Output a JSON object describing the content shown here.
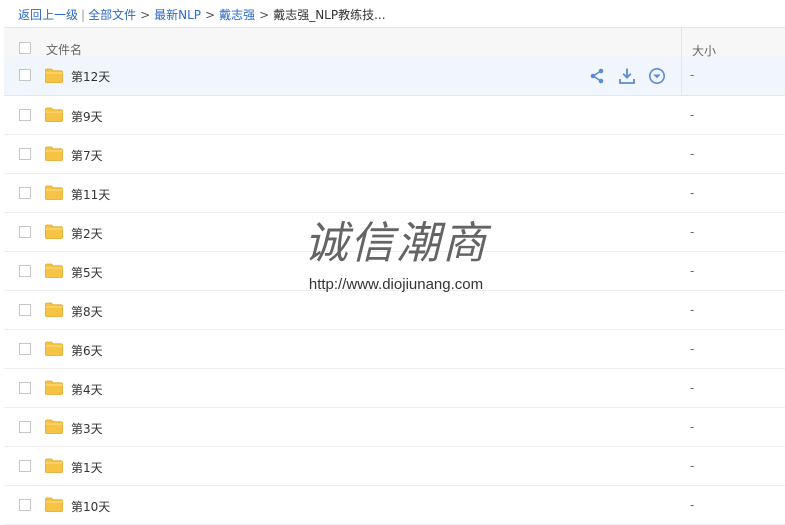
{
  "breadcrumb": {
    "back": "返回上一级",
    "divider": "|",
    "all_files": "全部文件",
    "gt": ">",
    "level1": "最新NLP",
    "level2": "戴志强",
    "current": "戴志强_NLP教练技..."
  },
  "header": {
    "name_label": "文件名",
    "size_label": "大小"
  },
  "files": [
    {
      "name": "第12天",
      "size": "-"
    },
    {
      "name": "第9天",
      "size": "-"
    },
    {
      "name": "第7天",
      "size": "-"
    },
    {
      "name": "第11天",
      "size": "-"
    },
    {
      "name": "第2天",
      "size": "-"
    },
    {
      "name": "第5天",
      "size": "-"
    },
    {
      "name": "第8天",
      "size": "-"
    },
    {
      "name": "第6天",
      "size": "-"
    },
    {
      "name": "第4天",
      "size": "-"
    },
    {
      "name": "第3天",
      "size": "-"
    },
    {
      "name": "第1天",
      "size": "-"
    },
    {
      "name": "第10天",
      "size": "-"
    }
  ],
  "row_actions": [
    "share-icon",
    "download-icon",
    "more-icon"
  ],
  "watermark": {
    "cn": "诚信潮商",
    "url": "http://www.diojiunang.com"
  },
  "colors": {
    "link": "#2b6ac6",
    "folder": "#f6c344",
    "action_icon": "#5b8ccf",
    "hover_row": "#f1f6fc"
  }
}
